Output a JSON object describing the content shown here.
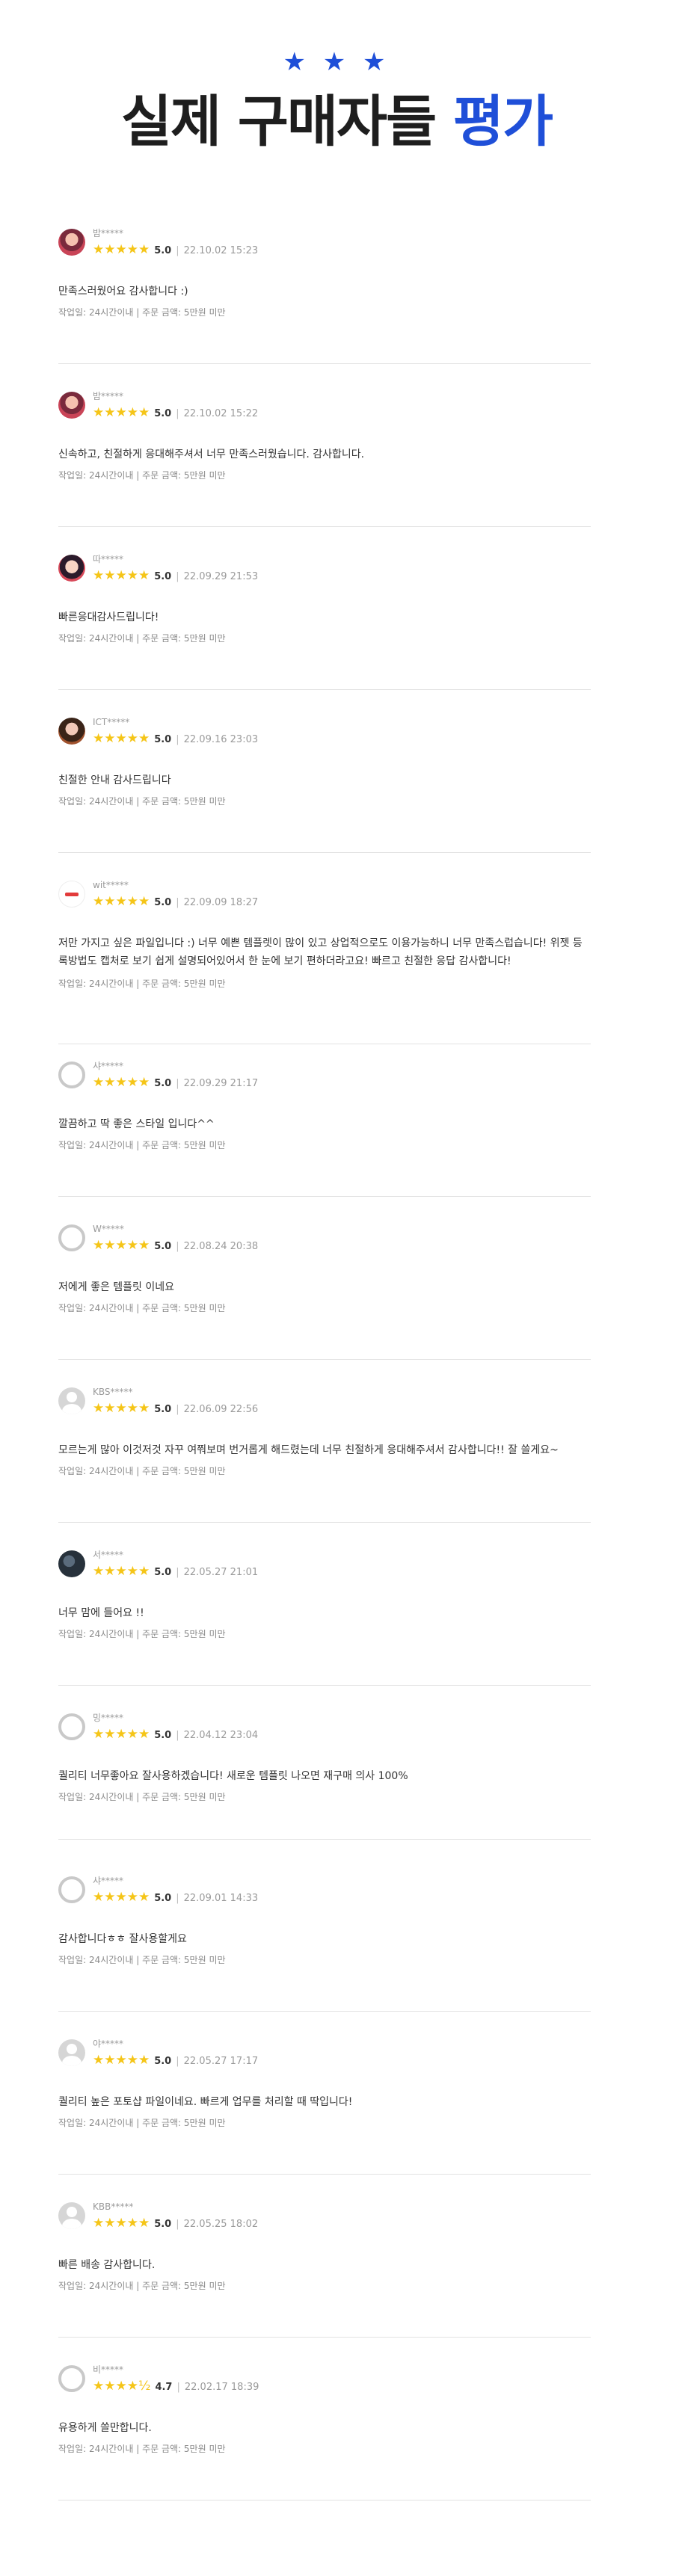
{
  "header": {
    "stars": "★ ★ ★",
    "title_main": "실제 구매자들 ",
    "title_accent": "평가",
    "accent_color": "#1f4fd8"
  },
  "reviews": [
    {
      "user": "밤*****",
      "stars": "★★★★★",
      "score": "5.0",
      "date": "22.10.02 15:23",
      "text": "만족스러웠어요 감사합니다 :)",
      "meta": "작업일: 24시간이내 | 주문 금액: 5만원 미만",
      "avatar": "photo"
    },
    {
      "user": "밤*****",
      "stars": "★★★★★",
      "score": "5.0",
      "date": "22.10.02 15:22",
      "text": "신속하고, 친절하게 응대해주셔서 너무 만족스러웠습니다. 감사합니다.",
      "meta": "작업일: 24시간이내 | 주문 금액: 5만원 미만",
      "avatar": "photo"
    },
    {
      "user": "따*****",
      "stars": "★★★★★",
      "score": "5.0",
      "date": "22.09.29 21:53",
      "text": "빠른응대감사드립니다!",
      "meta": "작업일: 24시간이내 | 주문 금액: 5만원 미만",
      "avatar": "photo2"
    },
    {
      "user": "ICT*****",
      "stars": "★★★★★",
      "score": "5.0",
      "date": "22.09.16 23:03",
      "text": "친절한 안내 감사드립니다",
      "meta": "작업일: 24시간이내 | 주문 금액: 5만원 미만",
      "avatar": "photo3"
    },
    {
      "user": "wit*****",
      "stars": "★★★★★",
      "score": "5.0",
      "date": "22.09.09 18:27",
      "text": "저만 가지고 싶은 파일입니다 :) 너무 예쁜 템플렛이 많이 있고 상업적으로도 이용가능하니 너무 만족스럽습니다! 위젯 등록방법도 캡처로 보기 쉽게 설명되어있어서 한 눈에 보기 편하더라고요! 빠르고 친절한 응답 감사합니다!",
      "meta": "작업일: 24시간이내 | 주문 금액: 5만원 미만",
      "avatar": "logo"
    },
    {
      "user": "샤*****",
      "stars": "★★★★★",
      "score": "5.0",
      "date": "22.09.29 21:17",
      "text": "깔끔하고 딱 좋은 스타일 입니다^^",
      "meta": "작업일: 24시간이내 | 주문 금액: 5만원 미만",
      "avatar": "ring"
    },
    {
      "user": "W*****",
      "stars": "★★★★★",
      "score": "5.0",
      "date": "22.08.24 20:38",
      "text": "저에게 좋은 템플릿 이네요",
      "meta": "작업일: 24시간이내 | 주문 금액: 5만원 미만",
      "avatar": "ring"
    },
    {
      "user": "KBS*****",
      "stars": "★★★★★",
      "score": "5.0",
      "date": "22.06.09 22:56",
      "text": "모르는게 많아 이것저것 자꾸 여쭤보며 번거롭게 해드렸는데 너무 친절하게 응대해주셔서 감사합니다!! 잘 쓸게요~",
      "meta": "작업일: 24시간이내 | 주문 금액: 5만원 미만",
      "avatar": "grey"
    },
    {
      "user": "서*****",
      "stars": "★★★★★",
      "score": "5.0",
      "date": "22.05.27 21:01",
      "text": "너무 맘에 들어요 !!",
      "meta": "작업일: 24시간이내 | 주문 금액: 5만원 미만",
      "avatar": "dark"
    },
    {
      "user": "밍*****",
      "stars": "★★★★★",
      "score": "5.0",
      "date": "22.04.12 23:04",
      "text": "퀄리티 너무좋아요 잘사용하겠습니다! 새로운 템플릿 나오면 재구매 의사 100%",
      "meta": "작업일: 24시간이내 | 주문 금액: 5만원 미만",
      "avatar": "ring"
    },
    {
      "user": "샤*****",
      "stars": "★★★★★",
      "score": "5.0",
      "date": "22.09.01 14:33",
      "text": "감사합니다ㅎㅎ 잘사용할게요",
      "meta": "작업일: 24시간이내 | 주문 금액: 5만원 미만",
      "avatar": "ring"
    },
    {
      "user": "야*****",
      "stars": "★★★★★",
      "score": "5.0",
      "date": "22.05.27 17:17",
      "text": "퀄리티 높은 포토샵 파일이네요. 빠르게 업무를 처리할 때 딱입니다!",
      "meta": "작업일: 24시간이내 | 주문 금액: 5만원 미만",
      "avatar": "grey"
    },
    {
      "user": "KBB*****",
      "stars": "★★★★★",
      "score": "5.0",
      "date": "22.05.25 18:02",
      "text": "빠른 배송 감사합니다.",
      "meta": "작업일: 24시간이내 | 주문 금액: 5만원 미만",
      "avatar": "grey"
    },
    {
      "user": "비*****",
      "stars": "★★★★½",
      "score": "4.7",
      "date": "22.02.17 18:39",
      "text": "유용하게 쓸만합니다.",
      "meta": "작업일: 24시간이내 | 주문 금액: 5만원 미만",
      "avatar": "ring"
    }
  ]
}
